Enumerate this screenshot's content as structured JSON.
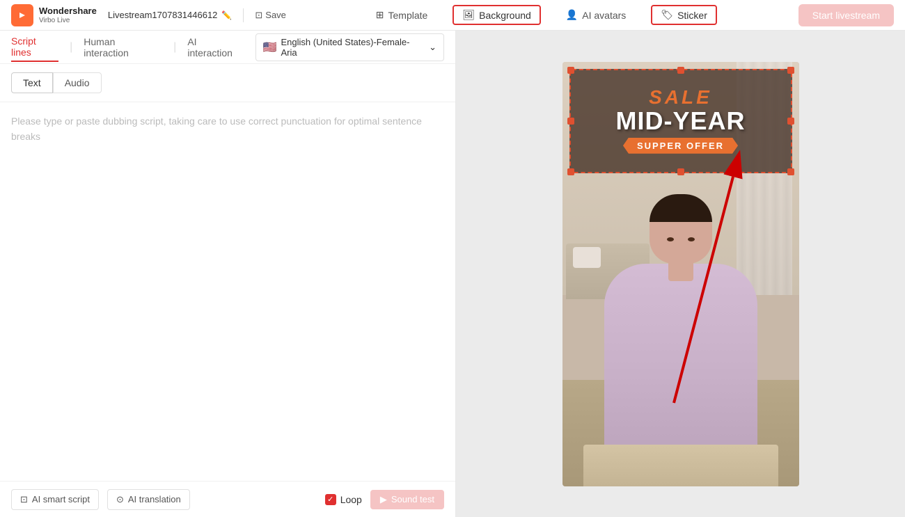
{
  "header": {
    "logo_brand": "Wondershare",
    "logo_product": "Virbo Live",
    "stream_name": "Livestream1707831446612",
    "save_label": "Save",
    "template_label": "Template",
    "background_label": "Background",
    "ai_avatars_label": "AI avatars",
    "sticker_label": "Sticker",
    "start_livestream_label": "Start livestream"
  },
  "left": {
    "tab_script": "Script lines",
    "tab_human": "Human interaction",
    "tab_ai": "AI interaction",
    "lang_label": "English (United States)-Female-Aria",
    "tab_text": "Text",
    "tab_audio": "Audio",
    "placeholder": "Please type or paste dubbing script, taking care to use correct punctuation for optimal sentence breaks",
    "ai_smart_script": "AI smart script",
    "ai_translation": "AI translation",
    "loop_label": "Loop",
    "sound_test_label": "Sound test"
  },
  "preview": {
    "sale_line1": "SALE",
    "sale_line2": "MID-YEAR",
    "sale_ribbon": "SUPPER OFFER"
  }
}
